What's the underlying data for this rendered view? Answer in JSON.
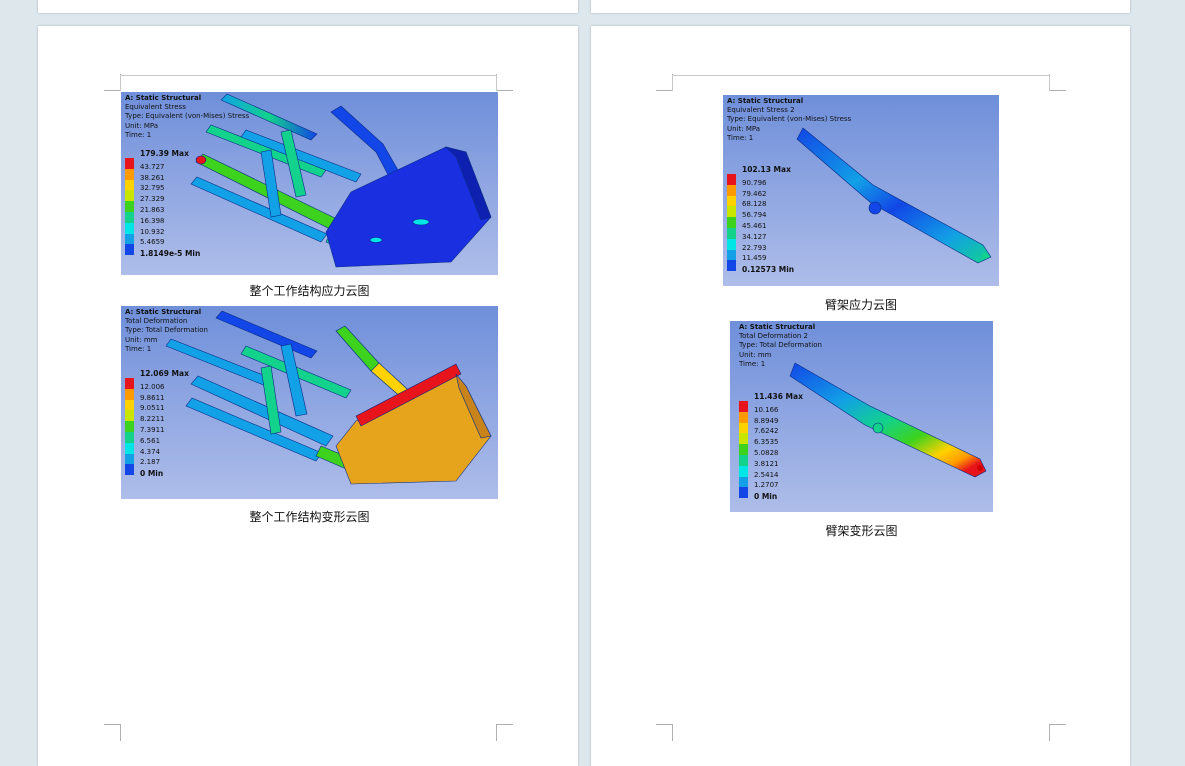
{
  "figures": {
    "whole_stress": {
      "title": "A: Static Structural",
      "lines": [
        "Equivalent Stress",
        "Type: Equivalent (von-Mises) Stress",
        "Unit: MPa",
        "Time: 1"
      ],
      "max": "179.39 Max",
      "values": [
        "43.727",
        "38.261",
        "32.795",
        "27.329",
        "21.863",
        "16.398",
        "10.932",
        "5.4659"
      ],
      "min": "1.8149e-5 Min",
      "caption": "整个工作结构应力云图"
    },
    "whole_deform": {
      "title": "A: Static Structural",
      "lines": [
        "Total Deformation",
        "Type: Total Deformation",
        "Unit: mm",
        "Time: 1"
      ],
      "max": "12.069 Max",
      "values": [
        "12.006",
        "9.8611",
        "9.0511",
        "8.2211",
        "7.3911",
        "6.561",
        "4.374",
        "2.187"
      ],
      "min": "0 Min",
      "caption": "整个工作结构变形云图"
    },
    "arm_stress": {
      "title": "A: Static Structural",
      "lines": [
        "Equivalent Stress 2",
        "Type: Equivalent (von-Mises) Stress",
        "Unit: MPa",
        "Time: 1"
      ],
      "max": "102.13 Max",
      "values": [
        "90.796",
        "79.462",
        "68.128",
        "56.794",
        "45.461",
        "34.127",
        "22.793",
        "11.459"
      ],
      "min": "0.12573 Min",
      "caption": "臂架应力云图"
    },
    "arm_deform": {
      "title": "A: Static Structural",
      "lines": [
        "Total Deformation 2",
        "Type: Total Deformation",
        "Unit: mm",
        "Time: 1"
      ],
      "max": "11.436 Max",
      "values": [
        "10.166",
        "8.8949",
        "7.6242",
        "6.3535",
        "5.0828",
        "3.8121",
        "2.5414",
        "1.2707"
      ],
      "min": "0 Min",
      "caption": "臂架变形云图"
    }
  },
  "legend_colors": [
    "#e8141b",
    "#ff9a00",
    "#ffd200",
    "#c8e600",
    "#3cd21e",
    "#12d28c",
    "#00e6e6",
    "#12a0e6",
    "#1246e6"
  ]
}
